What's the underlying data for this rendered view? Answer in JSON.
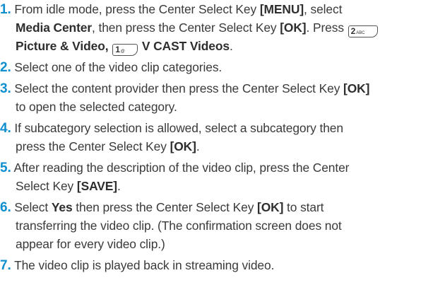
{
  "steps": [
    {
      "num": "1.",
      "l1_a": "From idle mode, press the Center Select Key ",
      "l1_b": "[MENU]",
      "l1_c": ", select",
      "l2_a": "Media Center",
      "l2_b": ", then press the Center Select Key ",
      "l2_c": "[OK]",
      "l2_d": ". Press ",
      "key2_main": "2",
      "key2_sub": "ABC",
      "l3_a": "Picture & Video",
      "l3_b": ", ",
      "key1_main": "1",
      "key1_sub": "@",
      "l3_c": " V CAST Videos",
      "l3_d": "."
    },
    {
      "num": "2.",
      "l1": "Select one of the video clip categories."
    },
    {
      "num": "3.",
      "l1_a": "Select the content provider then press the Center Select Key ",
      "l1_b": "[OK]",
      "l2": "to open the selected category."
    },
    {
      "num": "4.",
      "l1": "If subcategory selection is allowed, select a subcategory then",
      "l2_a": "press the Center Select Key ",
      "l2_b": "[OK]",
      "l2_c": "."
    },
    {
      "num": "5.",
      "l1": "After reading the description of the video clip, press the Center",
      "l2_a": "Select Key ",
      "l2_b": "[SAVE]",
      "l2_c": "."
    },
    {
      "num": "6.",
      "l1_a": "Select ",
      "l1_b": "Yes",
      "l1_c": " then press the Center Select Key ",
      "l1_d": "[OK]",
      "l1_e": " to start",
      "l2": "transferring the video clip. (The confirmation screen does not",
      "l3": "appear for every video clip.)"
    },
    {
      "num": "7.",
      "l1": "The video clip is played back in streaming video."
    }
  ]
}
